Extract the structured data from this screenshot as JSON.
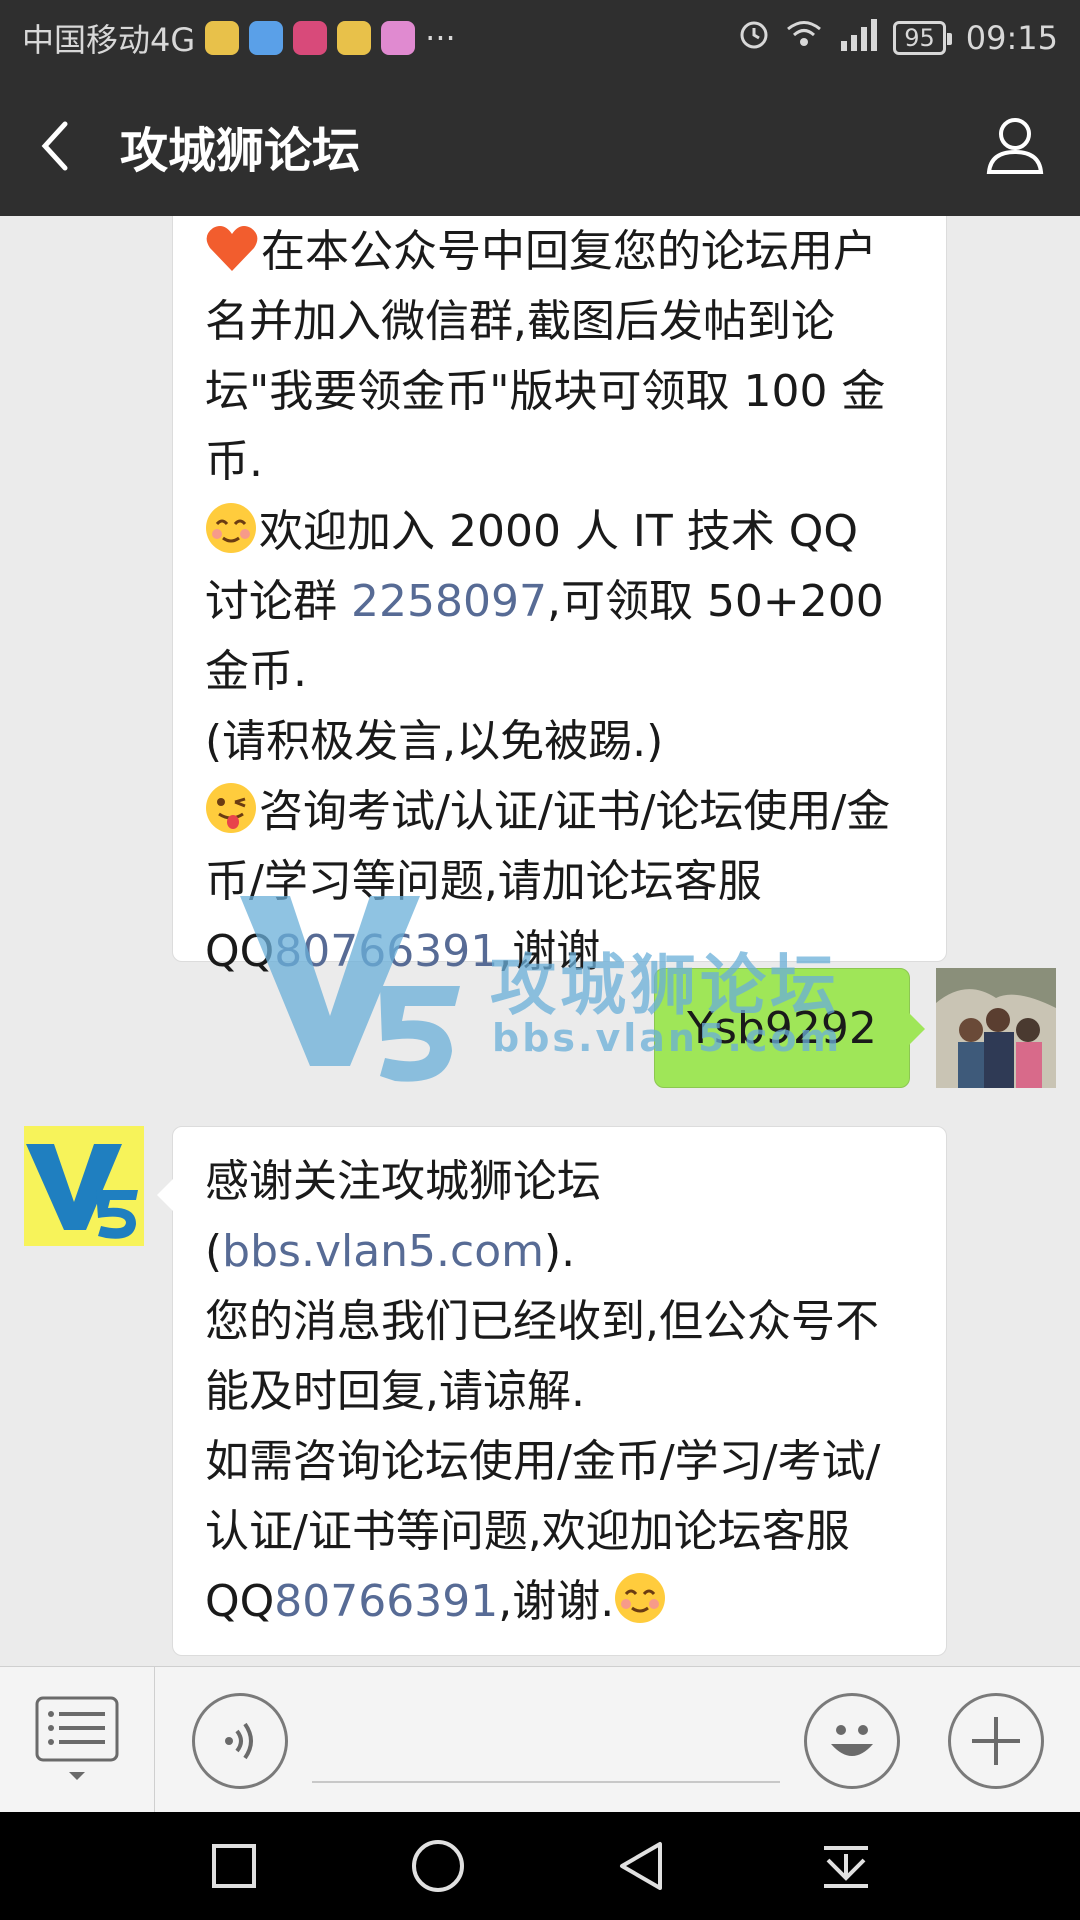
{
  "status_bar": {
    "carrier": "中国移动4G",
    "more": "···",
    "battery": "95",
    "time": "09:15",
    "colors": {
      "bg": "#2f2f2f",
      "text": "#d8d8d8"
    }
  },
  "header": {
    "title": "攻城狮论坛"
  },
  "messages": {
    "first": {
      "p1": "在本公众号中回复您的论坛用户名并加入微信群,截图后发帖到论坛\"我要领金币\"版块可领取 100 金币.",
      "p2_pre": "欢迎加入 2000 人 IT 技术 QQ 讨论群 ",
      "p2_link": "2258097",
      "p2_post": ",可领取 50+200 金币.",
      "p3": "(请积极发言,以免被踢.)",
      "p4": "咨询考试/认证/证书/论坛使用/金币/学习等问题,请加论坛客服",
      "p5_pre": "QQ",
      "p5_link": "80766391",
      "p5_post": ",谢谢"
    },
    "sent": {
      "text": "Ysb9292"
    },
    "second": {
      "p1_pre": "感谢关注攻城狮论坛(",
      "p1_link": "bbs.vlan5.com",
      "p1_post": ").",
      "p2": "您的消息我们已经收到,但公众号不能及时回复,请谅解.",
      "p3_pre": "如需咨询论坛使用/金币/学习/考试/认证/证书等问题,欢迎加论坛客服 QQ",
      "p3_link": "80766391",
      "p3_post": ",谢谢."
    }
  },
  "watermark": {
    "logo_text": "攻城狮论坛",
    "url": "bbs.vlan5.com",
    "mark": "V5"
  },
  "input": {
    "placeholder": ""
  },
  "colors": {
    "link": "#576b95",
    "sent_bubble": "#9fe658",
    "chat_bg": "#ebebeb"
  }
}
